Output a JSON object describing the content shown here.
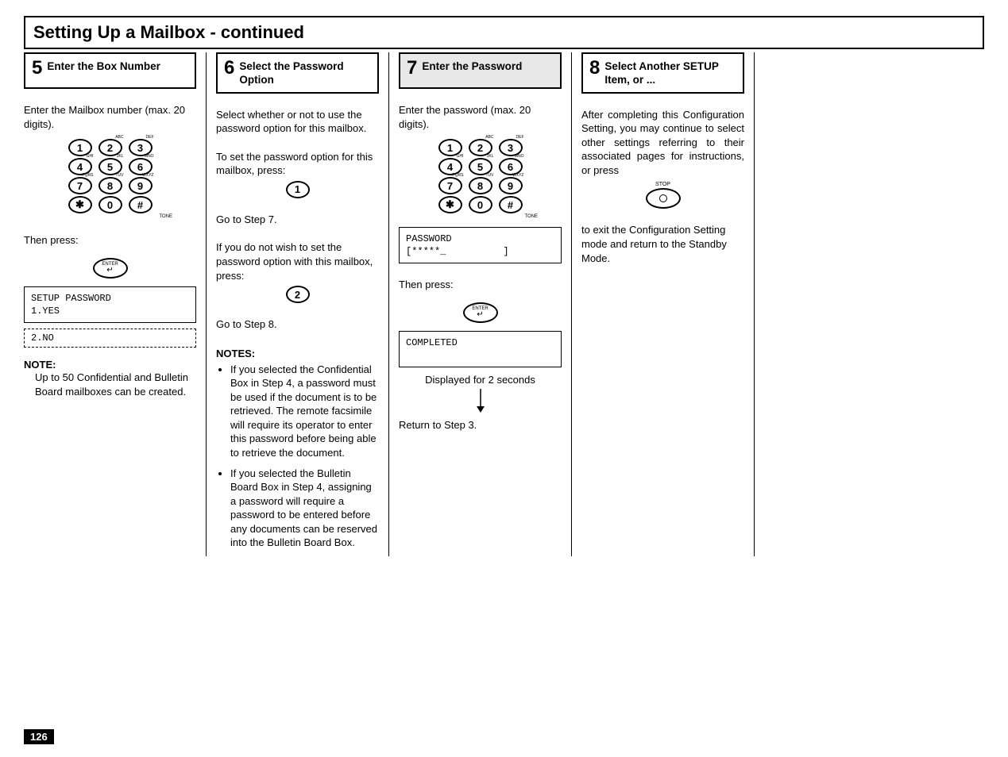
{
  "page_number": "126",
  "title": "Setting Up a Mailbox - continued",
  "steps": {
    "s5": {
      "num": "5",
      "title": "Enter the Box Number",
      "p1": "Enter the Mailbox number (max. 20 digits).",
      "then_press": "Then press:",
      "lcd_line1": "SETUP PASSWORD",
      "lcd_line2": "1.YES",
      "lcd_dashed": "2.NO",
      "note_h": "NOTE:",
      "note_body": "Up to 50 Confidential and Bulletin Board mailboxes can be created."
    },
    "s6": {
      "num": "6",
      "title": "Select the Password Option",
      "p1": "Select whether or not to use the password option for this mailbox.",
      "p2": "To set the password option for this mailbox, press:",
      "goto7": "Go to Step 7.",
      "p3": "If you do not wish to set the password option with this mailbox, press:",
      "goto8": "Go to Step 8.",
      "notes_h": "NOTES:",
      "note1": "If you selected the Confidential Box in Step 4, a password must be used if the document is to be retrieved. The remote facsimile will require its operator to enter this password before being able to retrieve the document.",
      "note2": "If you selected the Bulletin Board Box in Step 4, assigning a password will require a password to be entered before any documents can be reserved into the Bulletin Board Box."
    },
    "s7": {
      "num": "7",
      "title": "Enter the Password",
      "p1": "Enter the password (max. 20 digits).",
      "lcd_line1": "PASSWORD",
      "lcd_line2": "[*****_          ]",
      "then_press": "Then press:",
      "lcd_completed": "COMPLETED",
      "disp2s": "Displayed for 2 seconds",
      "return": "Return to Step 3."
    },
    "s8": {
      "num": "8",
      "title": "Select Another SETUP Item, or ...",
      "p1": "After completing this Configuration Setting, you may continue to select other settings referring to their associated pages for instructions, or press",
      "stop_label": "STOP",
      "p2": "to exit the Configuration Setting mode and return to the Standby Mode."
    }
  },
  "keys": {
    "k1": "1",
    "k2": "2",
    "k3": "3",
    "k4": "4",
    "k5": "5",
    "k6": "6",
    "k7": "7",
    "k8": "8",
    "k9": "9",
    "k0": "0",
    "kstar": "✱",
    "khash": "#",
    "abc": "ABC",
    "def": "DEF",
    "ghi": "GHI",
    "jkl": "JKL",
    "mno": "MNO",
    "pqrs": "PQRS",
    "tuv": "TUV",
    "wxyz": "WXYZ",
    "tone": "TONE",
    "enter": "ENTER"
  }
}
